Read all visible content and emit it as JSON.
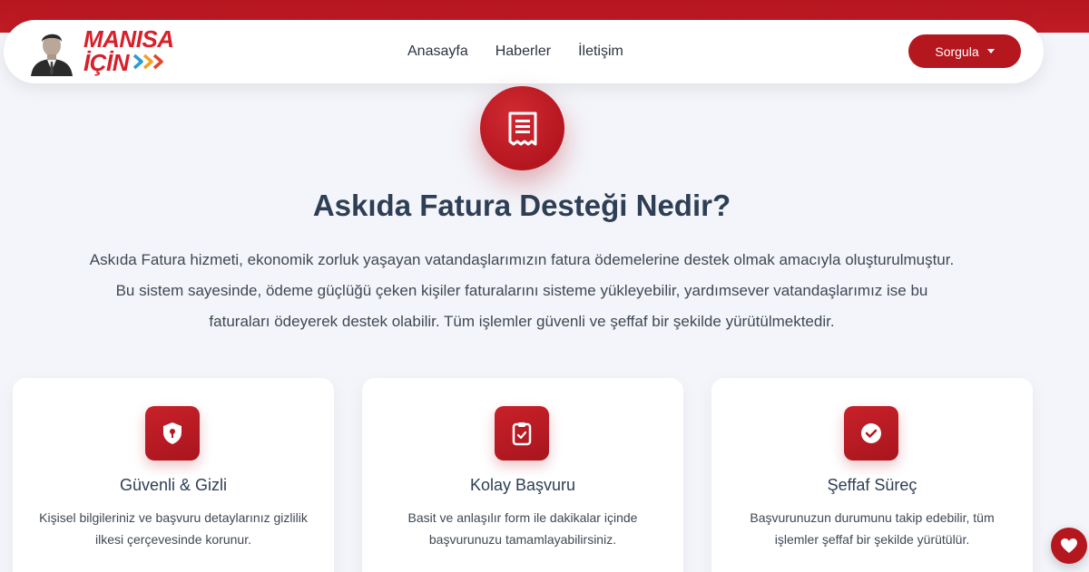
{
  "brand": {
    "line1": "MANISA",
    "line2": "İÇİN",
    "portrait_icon": "person-portrait",
    "accent": "#d7202a",
    "chevron_colors": [
      "#2a9bd6",
      "#f0a22b",
      "#e2452b"
    ]
  },
  "nav": {
    "links": [
      "Anasayfa",
      "Haberler",
      "İletişim"
    ],
    "sorgula_label": "Sorgula"
  },
  "hero": {
    "icon": "receipt-icon",
    "title": "Askıda Fatura Desteği Nedir?",
    "description": "Askıda Fatura hizmeti, ekonomik zorluk yaşayan vatandaşlarımızın fatura ödemelerine destek olmak amacıyla oluşturulmuştur. Bu sistem sayesinde, ödeme güçlüğü çeken kişiler faturalarını sisteme yükleyebilir, yardımsever vatandaşlarımız ise bu faturaları ödeyerek destek olabilir. Tüm işlemler güvenli ve şeffaf bir şekilde yürütülmektedir."
  },
  "features": [
    {
      "icon": "shield-icon",
      "title": "Güvenli & Gizli",
      "description": "Kişisel bilgileriniz ve başvuru detaylarınız gizlilik ilkesi çerçevesinde korunur."
    },
    {
      "icon": "clipboard-check-icon",
      "title": "Kolay Başvuru",
      "description": "Basit ve anlaşılır form ile dakikalar içinde başvurunuzu tamamlayabilirsiniz."
    },
    {
      "icon": "check-circle-icon",
      "title": "Şeffaf Süreç",
      "description": "Başvurunuzun durumunu takip edebilir, tüm işlemler şeffaf bir şekilde yürütülür."
    }
  ],
  "colors": {
    "primary": "#b5171f",
    "background": "#f3f5fa",
    "heading": "#2e3e55"
  }
}
